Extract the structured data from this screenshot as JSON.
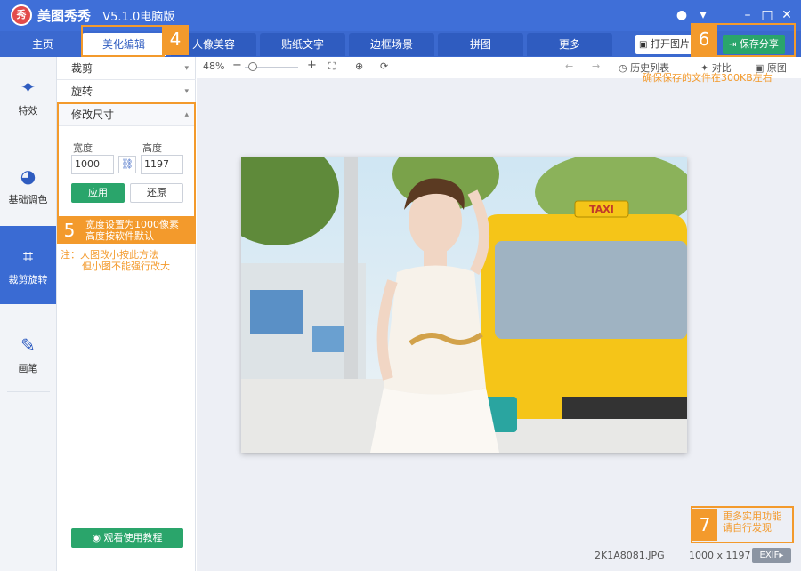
{
  "app": {
    "logo_text": "秀",
    "title": "美图秀秀",
    "version": "V5.1.0电脑版"
  },
  "window": {
    "chat_icon": "chat-icon",
    "menu_icon": "menu-icon",
    "min_icon": "minimize-icon",
    "max_icon": "maximize-icon",
    "close_icon": "close-icon"
  },
  "nav": {
    "tabs": [
      "主页",
      "美化编辑",
      "人像美容",
      "贴纸文字",
      "边框场景",
      "拼图",
      "更多"
    ],
    "active_index": 1,
    "open_label": "打开图片",
    "save_label": "保存分享"
  },
  "sidebar": {
    "items": [
      {
        "label": "特效",
        "icon": "magic-wand-icon"
      },
      {
        "label": "基础调色",
        "icon": "palette-icon"
      },
      {
        "label": "裁剪旋转",
        "icon": "crop-icon"
      },
      {
        "label": "画笔",
        "icon": "brush-icon"
      }
    ],
    "active_index": 2
  },
  "panel": {
    "crop_label": "裁剪",
    "rotate_label": "旋转",
    "resize_label": "修改尺寸",
    "width_label": "宽度",
    "height_label": "高度",
    "width_value": "1000",
    "height_value": "1197",
    "apply_label": "应用",
    "reset_label": "还原",
    "tutorial_label": "观看使用教程"
  },
  "toolbar": {
    "zoom": "48%",
    "minus": "−",
    "plus": "+",
    "history_label": "历史列表",
    "compare_label": "对比",
    "original_label": "原图"
  },
  "annotations": {
    "n4": "4",
    "n5": "5",
    "n6": "6",
    "n7": "7",
    "note5_line1": "宽度设置为1000像素",
    "note5_line2": "高度按软件默认",
    "note5b_line1": "注：大图改小按此方法",
    "note5b_line2": "但小图不能强行改大",
    "note6": "确保保存的文件在300KB左右",
    "note7_line1": "更多实用功能",
    "note7_line2": "请自行发现"
  },
  "status": {
    "filename": "2K1A8081.JPG",
    "dimensions": "1000 x 1197",
    "exif_label": "EXIF▸"
  },
  "photo": {
    "taxi_sign": "TAXI"
  },
  "colors": {
    "primary": "#3f6fd8",
    "accent_green": "#2aa56b",
    "annotation": "#f39a2c",
    "active_side": "#3a6bd3"
  }
}
